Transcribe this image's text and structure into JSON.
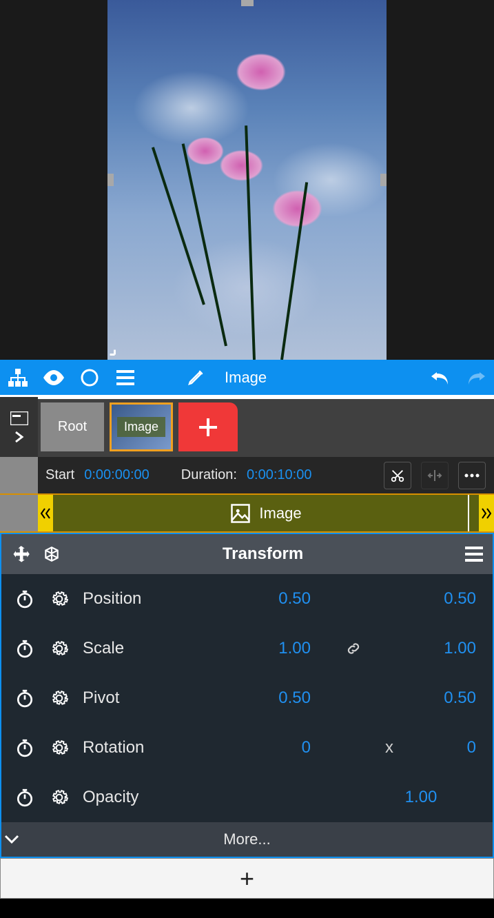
{
  "toolbar": {
    "edit_label": "Image"
  },
  "layers": {
    "root_label": "Root",
    "image_label": "Image"
  },
  "timing": {
    "start_label": "Start",
    "start_value": "0:00:00:00",
    "duration_label": "Duration:",
    "duration_value": "0:00:10:00"
  },
  "timeline": {
    "clip_label": "Image"
  },
  "transform": {
    "title": "Transform",
    "more_label": "More...",
    "props": [
      {
        "name": "Position",
        "v1": "0.50",
        "mid": "",
        "v2": "0.50"
      },
      {
        "name": "Scale",
        "v1": "1.00",
        "mid": "link",
        "v2": "1.00"
      },
      {
        "name": "Pivot",
        "v1": "0.50",
        "mid": "",
        "v2": "0.50"
      },
      {
        "name": "Rotation",
        "v1": "0",
        "mid": "x",
        "v2": "0"
      },
      {
        "name": "Opacity",
        "v1": "",
        "mid": "",
        "v2": "1.00"
      }
    ]
  },
  "colors": {
    "accent": "#0d90f0",
    "clip": "#5a6010",
    "handle": "#f0d000",
    "add": "#f03838",
    "value": "#2090f0"
  }
}
